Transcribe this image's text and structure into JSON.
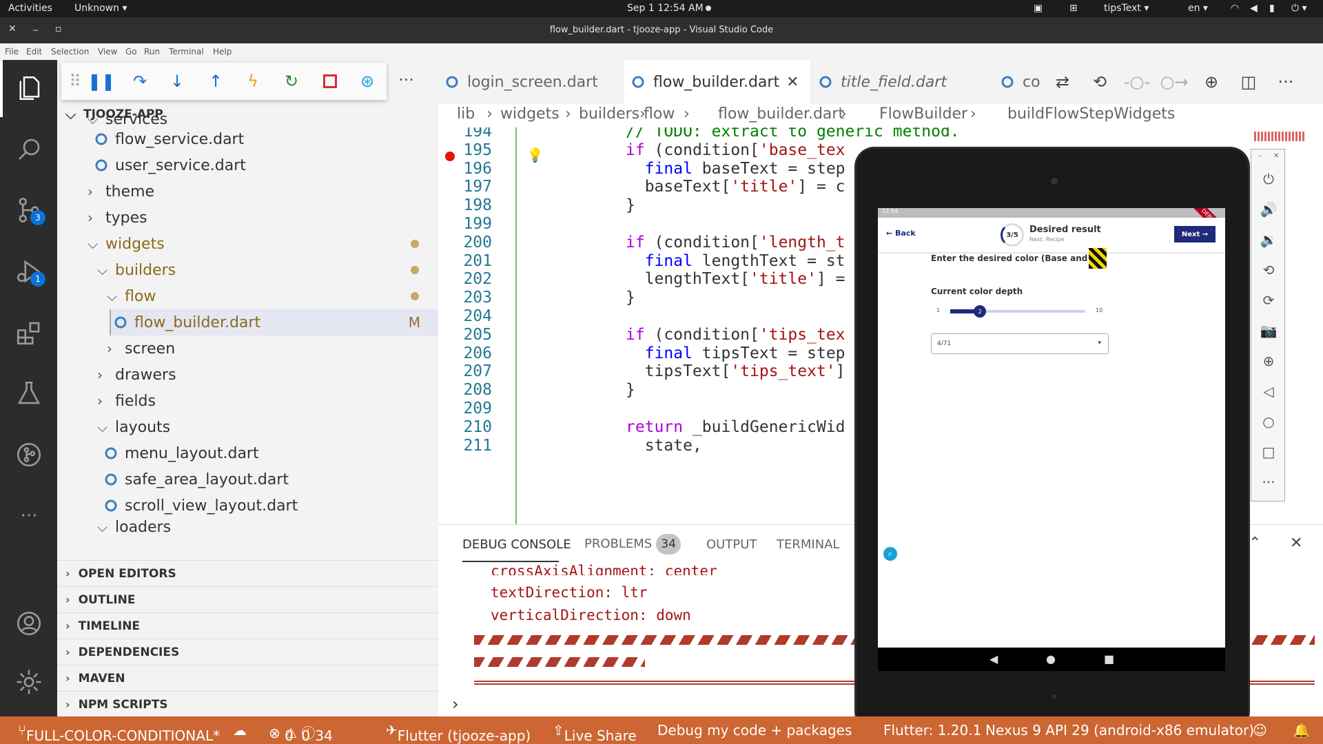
{
  "os": {
    "activities": "Activities",
    "app_menu": "Unknown ▾",
    "clock": "Sep 1  12:54 AM",
    "tips": "tipsText ▾",
    "lang": "en ▾"
  },
  "window": {
    "title": "flow_builder.dart - tjooze-app - Visual Studio Code",
    "close": "✕",
    "minimize": "_",
    "maximize": "▫"
  },
  "menu": [
    "File",
    "Edit",
    "Selection",
    "View",
    "Go",
    "Run",
    "Terminal",
    "Help"
  ],
  "activity": {
    "scm_badge": "3",
    "debug_badge": "1",
    "more": "···"
  },
  "explorer": {
    "root": "TJOOZE-APP",
    "items": [
      {
        "label": "services",
        "chev": "⌵"
      },
      {
        "label": "flow_service.dart"
      },
      {
        "label": "user_service.dart"
      },
      {
        "label": "theme",
        "chev": "›"
      },
      {
        "label": "types",
        "chev": "›"
      },
      {
        "label": "widgets",
        "chev": "⌵"
      },
      {
        "label": "builders",
        "chev": "⌵"
      },
      {
        "label": "flow",
        "chev": "⌵"
      },
      {
        "label": "flow_builder.dart",
        "flag": "M"
      },
      {
        "label": "screen",
        "chev": "›"
      },
      {
        "label": "drawers",
        "chev": "›"
      },
      {
        "label": "fields",
        "chev": "›"
      },
      {
        "label": "layouts",
        "chev": "⌵"
      },
      {
        "label": "menu_layout.dart"
      },
      {
        "label": "safe_area_layout.dart"
      },
      {
        "label": "scroll_view_layout.dart"
      },
      {
        "label": "loaders",
        "chev": "⌵"
      }
    ],
    "sections": [
      "OPEN EDITORS",
      "OUTLINE",
      "TIMELINE",
      "DEPENDENCIES",
      "MAVEN",
      "NPM SCRIPTS"
    ]
  },
  "tabs": [
    "login_screen.dart",
    "flow_builder.dart",
    "title_field.dart",
    "co"
  ],
  "breadcrumb": [
    "lib",
    "›",
    "widgets",
    "›",
    "builders",
    "›",
    "flow",
    "›",
    "flow_builder.dart",
    "›",
    "FlowBuilder",
    "›",
    "buildFlowStepWidgets"
  ],
  "code": {
    "line_numbers": [
      "194",
      "195",
      "196",
      "197",
      "198",
      "199",
      "200",
      "201",
      "202",
      "203",
      "204",
      "205",
      "206",
      "207",
      "208",
      "209",
      "210",
      "211"
    ],
    "lines": [
      "// TODO: extract to generic method.",
      "if (condition['base_tex",
      "  final baseText = step",
      "  baseText['title'] = c",
      "}",
      "",
      "if (condition['length_t",
      "  final lengthText = st",
      "  lengthText['title'] =",
      "}",
      "",
      "if (condition['tips_tex",
      "  final tipsText = step",
      "  tipsText['tips_text']",
      "}",
      "",
      "return _buildGenericWid",
      "  state,"
    ]
  },
  "panel": {
    "tabs": [
      "DEBUG CONSOLE",
      "PROBLEMS",
      "OUTPUT",
      "TERMINAL"
    ],
    "problems_count": "34",
    "lines": [
      "crossAxisAlignment: center",
      "textDirection: ltr",
      "verticalDirection: down"
    ],
    "prompt": "›"
  },
  "status": {
    "branch": "FULL-COLOR-CONDITIONAL*",
    "errors": "0",
    "warnings": "0",
    "infos": "34",
    "flutter": "Flutter (tjooze-app)",
    "live_share": "Live Share",
    "debug_mode": "Debug my code + packages",
    "flutter_version": "Flutter: 1.20.1",
    "device": "Nexus 9 API 29 (android-x86 emulator)"
  },
  "emulator": {
    "status_time": "12:54",
    "back": "Back",
    "step": "3/5",
    "step_title": "Desired result",
    "step_next": "Next: Recipe",
    "next_button": "Next",
    "question": "Enter the desired color (Base and Lo",
    "slider_label": "Current color depth",
    "slider_min": "1",
    "slider_max": "10",
    "slider_value": "2",
    "slider_fraction": 0.22,
    "select_value": "4/71",
    "accent": "#1f2a7a",
    "debug_banner": "DEBUG"
  }
}
